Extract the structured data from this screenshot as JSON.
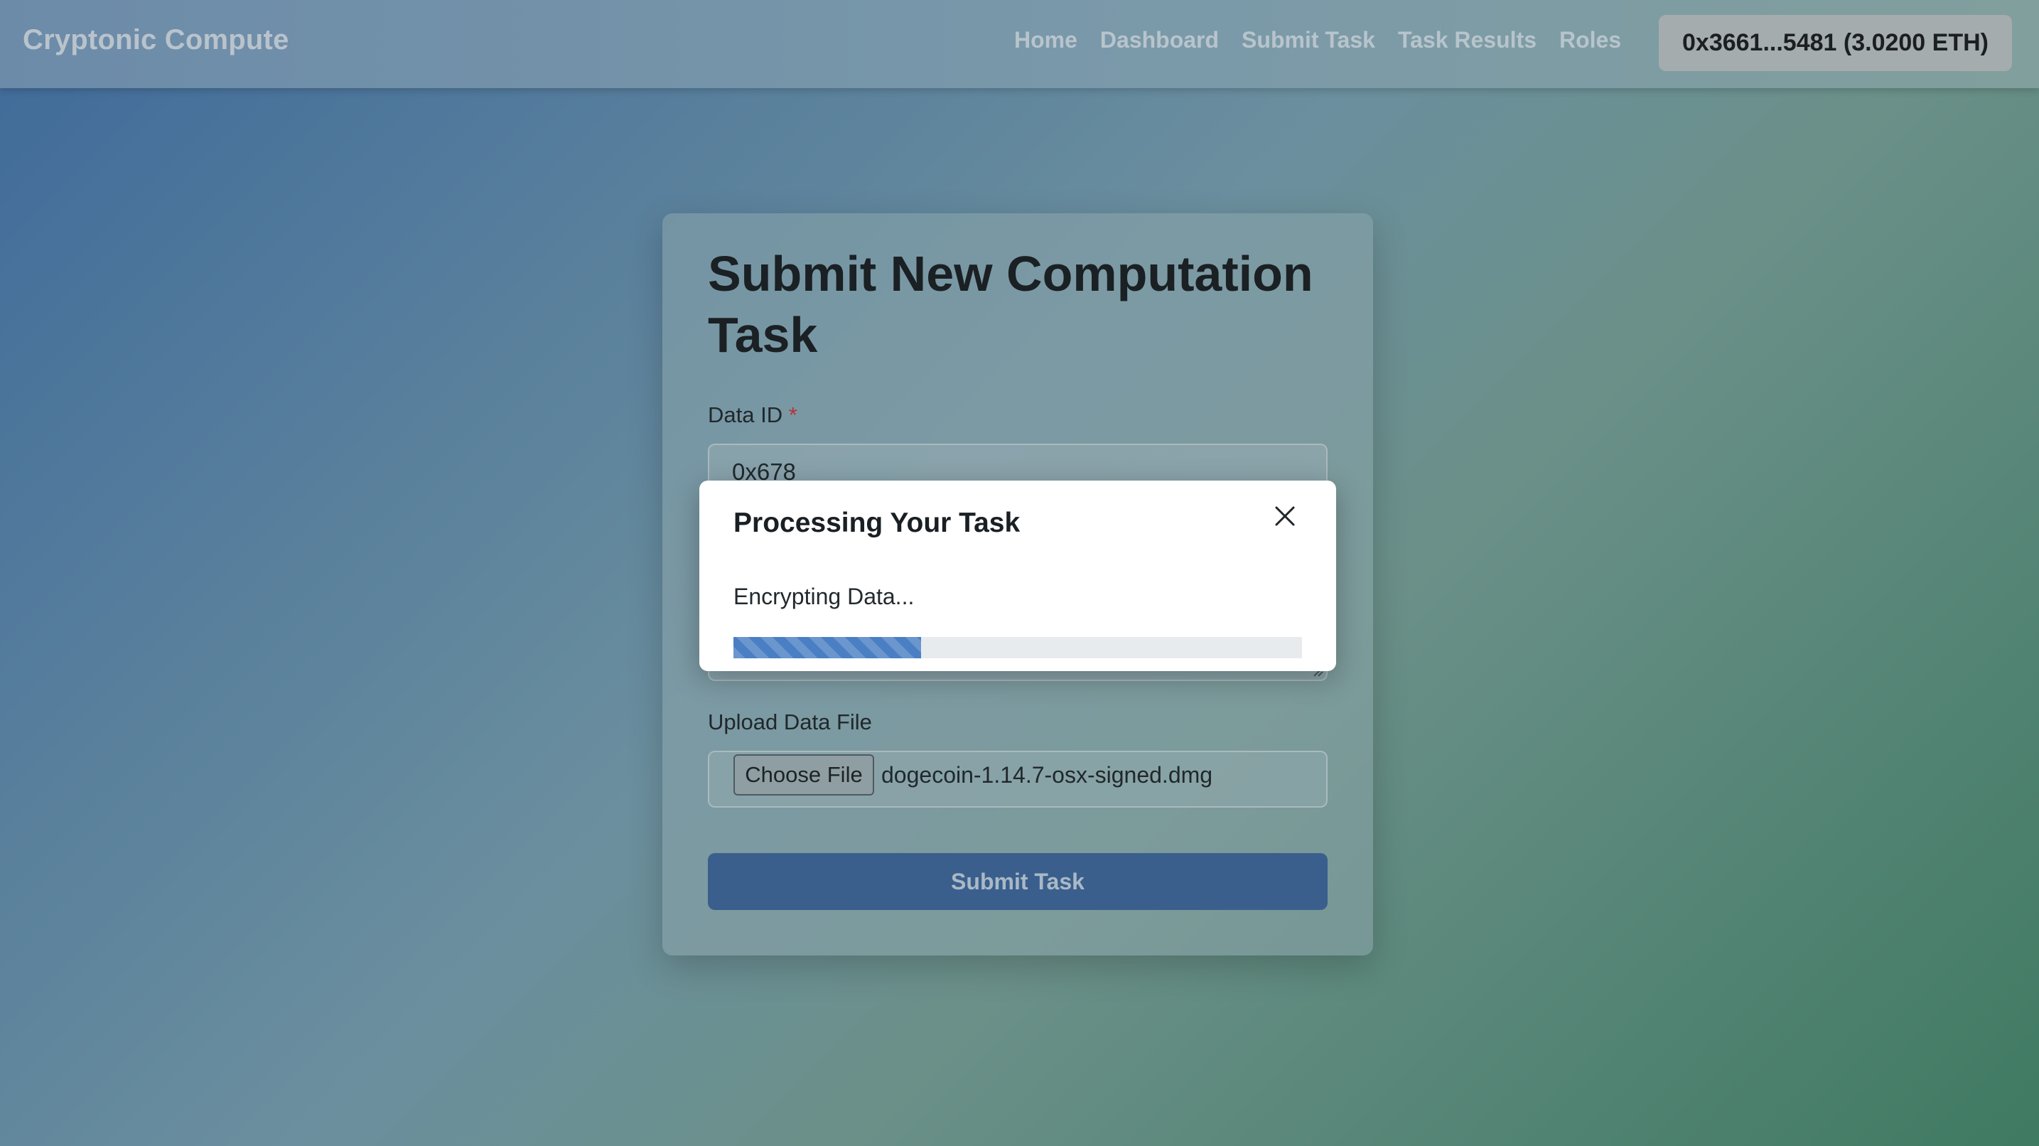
{
  "app": {
    "brand": "Cryptonic Compute"
  },
  "nav": {
    "items": [
      {
        "label": "Home"
      },
      {
        "label": "Dashboard"
      },
      {
        "label": "Submit Task"
      },
      {
        "label": "Task Results"
      },
      {
        "label": "Roles"
      }
    ],
    "wallet_label": "0x3661...5481 (3.0200 ETH)"
  },
  "form": {
    "title": "Submit New Computation Task",
    "data_id": {
      "label": "Data ID",
      "required_marker": "*",
      "value": "0x678"
    },
    "upload": {
      "label": "Upload Data File",
      "button_label": "Choose File",
      "file_name": "dogecoin-1.14.7-osx-signed.dmg"
    },
    "submit_label": "Submit Task"
  },
  "modal": {
    "title": "Processing Your Task",
    "status": "Encrypting Data...",
    "progress_fraction": 0.33
  },
  "colors": {
    "progress_fill": "#4a7fc3",
    "submit_button": "#3a5f8c",
    "required_marker": "#b4343a"
  }
}
